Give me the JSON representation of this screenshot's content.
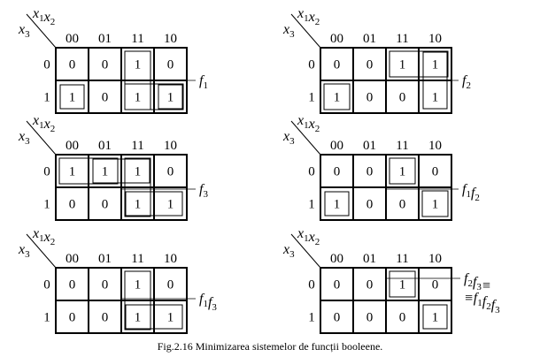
{
  "figure": {
    "caption": "Fig.2.16 Minimizarea sistemelor de funcții booleene."
  },
  "kmaps": [
    {
      "id": "f1",
      "col_headers": [
        "00",
        "01",
        "11",
        "10"
      ],
      "row_headers": [
        "0",
        "1"
      ],
      "cells": [
        [
          "0",
          "0",
          "1",
          "0"
        ],
        [
          "1",
          "0",
          "1",
          "1"
        ]
      ],
      "label_lines": [
        [
          [
            "f",
            "1"
          ]
        ]
      ],
      "groups": [
        {
          "cells": [
            [
              0,
              2
            ],
            [
              1,
              2
            ]
          ]
        },
        {
          "cells": [
            [
              1,
              0
            ]
          ]
        },
        {
          "cells": [
            [
              1,
              2
            ],
            [
              1,
              3
            ]
          ]
        },
        {
          "cells": [
            [
              1,
              3
            ]
          ]
        }
      ]
    },
    {
      "id": "f2",
      "col_headers": [
        "00",
        "01",
        "11",
        "10"
      ],
      "row_headers": [
        "0",
        "1"
      ],
      "cells": [
        [
          "0",
          "0",
          "1",
          "1"
        ],
        [
          "1",
          "0",
          "0",
          "1"
        ]
      ],
      "label_lines": [
        [
          [
            "f",
            "2"
          ]
        ]
      ],
      "groups": [
        {
          "cells": [
            [
              0,
              2
            ],
            [
              0,
              3
            ]
          ]
        },
        {
          "cells": [
            [
              0,
              3
            ],
            [
              1,
              3
            ]
          ]
        },
        {
          "cells": [
            [
              1,
              0
            ]
          ]
        }
      ]
    },
    {
      "id": "f3",
      "col_headers": [
        "00",
        "01",
        "11",
        "10"
      ],
      "row_headers": [
        "0",
        "1"
      ],
      "cells": [
        [
          "1",
          "1",
          "1",
          "0"
        ],
        [
          "0",
          "0",
          "1",
          "1"
        ]
      ],
      "label_lines": [
        [
          [
            "f",
            "3"
          ]
        ]
      ],
      "groups": [
        {
          "cells": [
            [
              0,
              0
            ],
            [
              0,
              1
            ]
          ]
        },
        {
          "cells": [
            [
              0,
              1
            ],
            [
              0,
              2
            ]
          ]
        },
        {
          "cells": [
            [
              0,
              2
            ],
            [
              1,
              2
            ]
          ]
        },
        {
          "cells": [
            [
              1,
              2
            ],
            [
              1,
              3
            ]
          ]
        }
      ]
    },
    {
      "id": "f1f2",
      "col_headers": [
        "00",
        "01",
        "11",
        "10"
      ],
      "row_headers": [
        "0",
        "1"
      ],
      "cells": [
        [
          "0",
          "0",
          "1",
          "0"
        ],
        [
          "1",
          "0",
          "0",
          "1"
        ]
      ],
      "label_lines": [
        [
          [
            "f",
            "1"
          ],
          [
            "f",
            "2"
          ]
        ]
      ],
      "groups": [
        {
          "cells": [
            [
              0,
              2
            ]
          ]
        },
        {
          "cells": [
            [
              1,
              0
            ]
          ]
        },
        {
          "cells": [
            [
              1,
              3
            ]
          ]
        }
      ]
    },
    {
      "id": "f1f3",
      "col_headers": [
        "00",
        "01",
        "11",
        "10"
      ],
      "row_headers": [
        "0",
        "1"
      ],
      "cells": [
        [
          "0",
          "0",
          "1",
          "0"
        ],
        [
          "0",
          "0",
          "1",
          "1"
        ]
      ],
      "label_lines": [
        [
          [
            "f",
            "1"
          ],
          [
            "f",
            "3"
          ]
        ]
      ],
      "groups": [
        {
          "cells": [
            [
              0,
              2
            ],
            [
              1,
              2
            ]
          ]
        },
        {
          "cells": [
            [
              1,
              2
            ],
            [
              1,
              3
            ]
          ]
        }
      ]
    },
    {
      "id": "f2f3",
      "col_headers": [
        "00",
        "01",
        "11",
        "10"
      ],
      "row_headers": [
        "0",
        "1"
      ],
      "cells": [
        [
          "0",
          "0",
          "1",
          "0"
        ],
        [
          "0",
          "0",
          "0",
          "1"
        ]
      ],
      "label_lines": [
        [
          [
            "f",
            "2"
          ],
          [
            "f",
            "3"
          ],
          [
            "≡",
            ""
          ]
        ],
        [
          [
            "≡",
            ""
          ],
          [
            "f",
            "1"
          ],
          [
            "f",
            "2"
          ],
          [
            "f",
            "3"
          ]
        ]
      ],
      "groups": [
        {
          "cells": [
            [
              0,
              2
            ]
          ]
        },
        {
          "cells": [
            [
              1,
              3
            ]
          ]
        }
      ]
    }
  ],
  "axis_vars": {
    "row": [
      "x",
      "3"
    ],
    "col": [
      [
        "x",
        "1"
      ],
      [
        "x",
        "2"
      ]
    ]
  }
}
